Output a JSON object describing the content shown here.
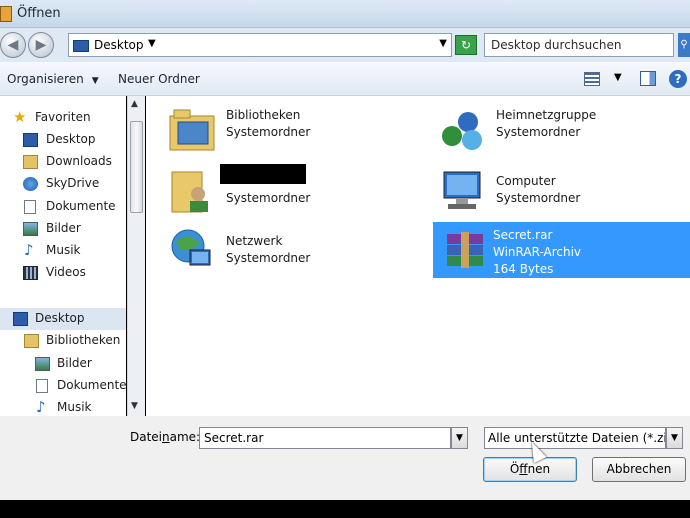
{
  "window": {
    "title": "Öffnen"
  },
  "nav": {
    "address": "Desktop",
    "search_placeholder": "Desktop durchsuchen"
  },
  "toolbar": {
    "organize": "Organisieren",
    "new_folder": "Neuer Ordner"
  },
  "sidebar": {
    "items": [
      {
        "label": "Favoriten",
        "icon": "star-icon"
      },
      {
        "label": "Desktop",
        "icon": "desktop-icon"
      },
      {
        "label": "Downloads",
        "icon": "downloads-folder-icon"
      },
      {
        "label": "SkyDrive",
        "icon": "skydrive-icon"
      },
      {
        "label": "Dokumente",
        "icon": "documents-icon"
      },
      {
        "label": "Bilder",
        "icon": "pictures-icon"
      },
      {
        "label": "Musik",
        "icon": "music-icon"
      },
      {
        "label": "Videos",
        "icon": "videos-icon"
      },
      {
        "label": "Desktop",
        "icon": "desktop-icon"
      },
      {
        "label": "Bibliotheken",
        "icon": "libraries-icon"
      },
      {
        "label": "Bilder",
        "icon": "pictures-icon"
      },
      {
        "label": "Dokumente",
        "icon": "documents-icon"
      },
      {
        "label": "Musik",
        "icon": "music-icon"
      }
    ]
  },
  "items": [
    {
      "name": "Bibliotheken",
      "type": "Systemordner",
      "extra": ""
    },
    {
      "name": "Heimnetzgruppe",
      "type": "Systemordner",
      "extra": ""
    },
    {
      "name": "",
      "type": "Systemordner",
      "extra": ""
    },
    {
      "name": "Computer",
      "type": "Systemordner",
      "extra": ""
    },
    {
      "name": "Netzwerk",
      "type": "Systemordner",
      "extra": ""
    },
    {
      "name": "Secret.rar",
      "type": "WinRAR-Archiv",
      "extra": "164 Bytes"
    }
  ],
  "footer": {
    "filename_label_pre": "Datei",
    "filename_label_u": "n",
    "filename_label_post": "ame:",
    "filename_value": "Secret.rar",
    "filter_value": "Alle unterstützte Dateien (*.zip;*",
    "open_label_pre": "Ö",
    "open_label_u": "f",
    "open_label_post": "fnen",
    "cancel_label": "Abbrechen"
  },
  "colors": {
    "selection": "#3399ff",
    "accent": "#2b5da8"
  }
}
